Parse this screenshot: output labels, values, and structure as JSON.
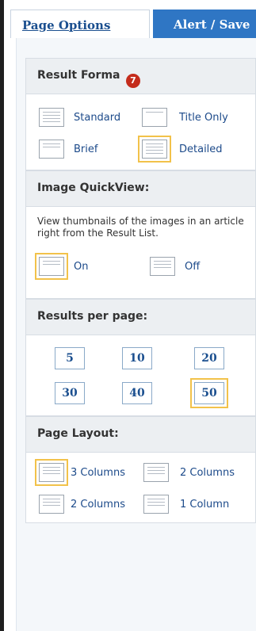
{
  "tabs": {
    "page_options": "Page Options",
    "alert_save": "Alert / Save"
  },
  "result_format": {
    "title": "Result Forma",
    "badge": "7",
    "options": [
      {
        "label": "Standard",
        "icon": "standard-format-icon",
        "selected": false
      },
      {
        "label": "Title Only",
        "icon": "title-only-format-icon",
        "selected": false
      },
      {
        "label": "Brief",
        "icon": "brief-format-icon",
        "selected": false
      },
      {
        "label": "Detailed",
        "icon": "detailed-format-icon",
        "selected": true
      }
    ]
  },
  "image_quickview": {
    "title": "Image QuickView:",
    "description": "View thumbnails of the images in an article right from the Result List.",
    "options": [
      {
        "label": "On",
        "icon": "thumbnails-on-icon",
        "selected": true
      },
      {
        "label": "Off",
        "icon": "thumbnails-off-icon",
        "selected": false
      }
    ]
  },
  "results_per_page": {
    "title": "Results per page:",
    "options": [
      "5",
      "10",
      "20",
      "30",
      "40",
      "50"
    ],
    "selected": "50"
  },
  "page_layout": {
    "title": "Page Layout:",
    "options": [
      {
        "label": "3 Columns",
        "icon": "three-column-layout-icon",
        "selected": true
      },
      {
        "label": "2 Columns",
        "icon": "two-column-layout-icon",
        "selected": false
      },
      {
        "label": "2 Columns",
        "icon": "two-column-alt-layout-icon",
        "selected": false
      },
      {
        "label": "1 Column",
        "icon": "one-column-layout-icon",
        "selected": false
      }
    ]
  },
  "colors": {
    "tab_active_text": "#1b4f8f",
    "tab_inactive_bg": "#2f76c4",
    "selection_outline": "#f2c24a",
    "badge": "#c42c1c"
  }
}
